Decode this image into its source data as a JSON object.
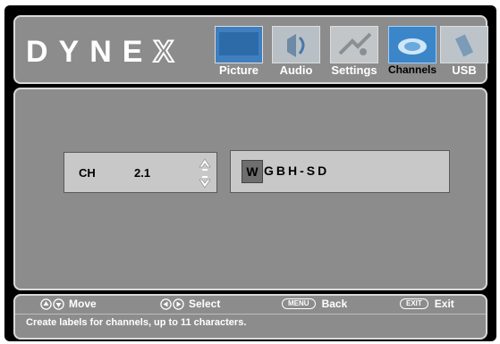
{
  "brand": {
    "logo": "DYNE",
    "logo_x": "X"
  },
  "menu_tabs": [
    {
      "label": "Picture",
      "icon": "picture-icon",
      "active": false
    },
    {
      "label": "Audio",
      "icon": "audio-icon",
      "active": false
    },
    {
      "label": "Settings",
      "icon": "settings-icon",
      "active": false
    },
    {
      "label": "Channels",
      "icon": "channels-icon",
      "active": true
    },
    {
      "label": "USB",
      "icon": "usb-icon",
      "active": false
    }
  ],
  "channel_editor": {
    "ch_label": "CH",
    "channel_number": "2.1",
    "label_cursor_char": "W",
    "label_rest": "GBH-SD"
  },
  "hints": {
    "move": "Move",
    "select": "Select",
    "menu_key": "MENU",
    "back": "Back",
    "exit_key": "EXIT",
    "exit": "Exit"
  },
  "help_text": "Create labels for channels, up to 11 characters.",
  "colors": {
    "panel": "#8c8c8c",
    "frame": "#000000",
    "active_tab": "#4a90c8",
    "field": "#c8c8c8"
  }
}
